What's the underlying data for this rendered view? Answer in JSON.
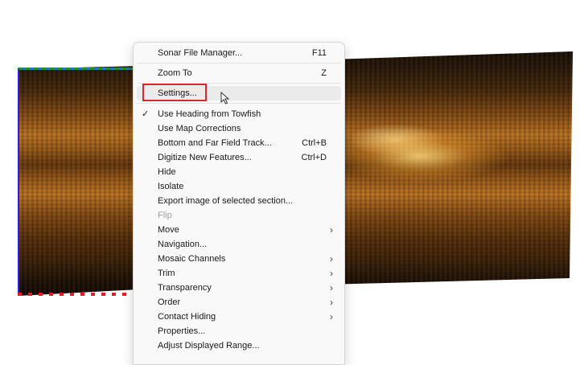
{
  "menu": {
    "items": [
      {
        "label": "Sonar File Manager...",
        "shortcut": "F11"
      },
      {
        "label": "Zoom To",
        "shortcut": "Z"
      },
      {
        "label": "Settings..."
      },
      {
        "label": "Use Heading from Towfish",
        "checked": true
      },
      {
        "label": "Use Map Corrections"
      },
      {
        "label": "Bottom and Far Field Track...",
        "shortcut": "Ctrl+B"
      },
      {
        "label": "Digitize New Features...",
        "shortcut": "Ctrl+D"
      },
      {
        "label": "Hide"
      },
      {
        "label": "Isolate"
      },
      {
        "label": "Export image of selected section..."
      },
      {
        "label": "Flip",
        "disabled": true
      },
      {
        "label": "Move",
        "submenu": true
      },
      {
        "label": "Navigation..."
      },
      {
        "label": "Mosaic Channels",
        "submenu": true
      },
      {
        "label": "Trim",
        "submenu": true
      },
      {
        "label": "Transparency",
        "submenu": true
      },
      {
        "label": "Order",
        "submenu": true
      },
      {
        "label": "Contact Hiding",
        "submenu": true
      },
      {
        "label": "Properties..."
      },
      {
        "label": "Adjust Displayed Range..."
      }
    ],
    "check_glyph": "✓",
    "chevron_glyph": "›"
  },
  "colors": {
    "highlight_border": "#e0242a",
    "menu_background": "#f9f9f9"
  },
  "icons": [
    "check-icon",
    "chevron-right-icon",
    "mouse-cursor-icon"
  ]
}
